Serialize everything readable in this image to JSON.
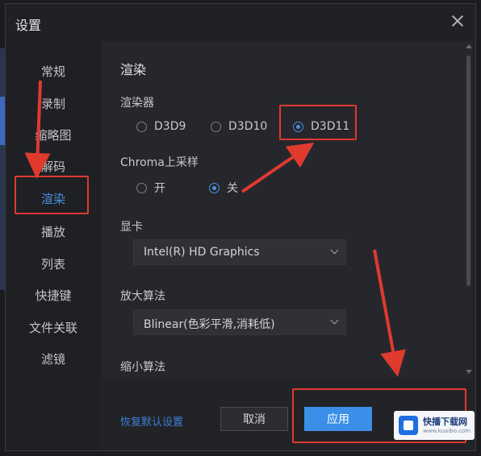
{
  "window": {
    "title": "设置"
  },
  "sidebar": {
    "items": [
      {
        "label": "常规"
      },
      {
        "label": "录制"
      },
      {
        "label": "缩略图"
      },
      {
        "label": "解码"
      },
      {
        "label": "渲染",
        "active": true
      },
      {
        "label": "播放"
      },
      {
        "label": "列表"
      },
      {
        "label": "快捷键"
      },
      {
        "label": "文件关联"
      },
      {
        "label": "滤镜"
      }
    ]
  },
  "main": {
    "section_title": "渲染",
    "renderer": {
      "label": "渲染器",
      "options": [
        "D3D9",
        "D3D10",
        "D3D11"
      ],
      "selected": "D3D11"
    },
    "chroma": {
      "label": "Chroma上采样",
      "options": [
        "开",
        "关"
      ],
      "selected": "关"
    },
    "gpu": {
      "label": "显卡",
      "value": "Intel(R) HD Graphics"
    },
    "upscale": {
      "label": "放大算法",
      "value": "Blinear(色彩平滑,消耗低)"
    },
    "downscale": {
      "label": "缩小算法"
    }
  },
  "footer": {
    "restore_label": "恢复默认设置",
    "cancel_label": "取消",
    "apply_label": "应用"
  },
  "watermark": {
    "text": "快播下载网",
    "sub": "www.kuaibo.com"
  },
  "colors": {
    "accent": "#4a90e2",
    "annotation": "#e03a2f",
    "apply_button": "#3b8fe8"
  }
}
